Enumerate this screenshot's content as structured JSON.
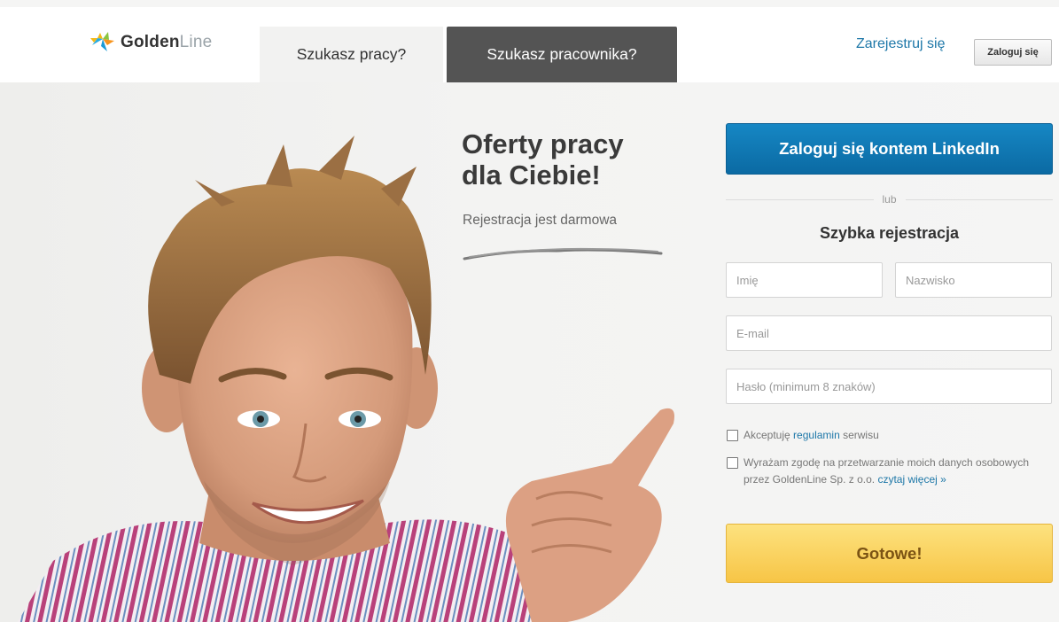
{
  "header": {
    "logo": {
      "brand_bold": "Golden",
      "brand_light": "Line"
    },
    "tabs": [
      {
        "label": "Szukasz pracy?",
        "active": true
      },
      {
        "label": "Szukasz pracownika?",
        "active": false
      }
    ],
    "register_link": "Zarejestruj się",
    "login_button": "Zaloguj się"
  },
  "hero": {
    "headline_line1": "Oferty pracy",
    "headline_line2": "dla Ciebie!",
    "subline": "Rejestracja jest darmowa"
  },
  "form": {
    "linkedin_button": "Zaloguj się kontem LinkedIn",
    "or_label": "lub",
    "title": "Szybka rejestracja",
    "fields": {
      "first_name": {
        "placeholder": "Imię",
        "value": ""
      },
      "last_name": {
        "placeholder": "Nazwisko",
        "value": ""
      },
      "email": {
        "placeholder": "E-mail",
        "value": ""
      },
      "password": {
        "placeholder": "Hasło (minimum 8 znaków)",
        "value": ""
      }
    },
    "checkbox_terms": {
      "checked": false,
      "text_before": "Akceptuję ",
      "link": "regulamin",
      "text_after": " serwisu"
    },
    "checkbox_data": {
      "checked": false,
      "text": "Wyrażam zgodę na przetwarzanie moich danych osobowych przez GoldenLine Sp. z o.o. ",
      "link": "czytaj więcej »"
    },
    "submit_button": "Gotowe!"
  },
  "colors": {
    "accent_link": "#1d77a8",
    "linkedin_blue": "#0b6aa3",
    "submit_yellow": "#f7c546",
    "dark_tab": "#545454"
  }
}
